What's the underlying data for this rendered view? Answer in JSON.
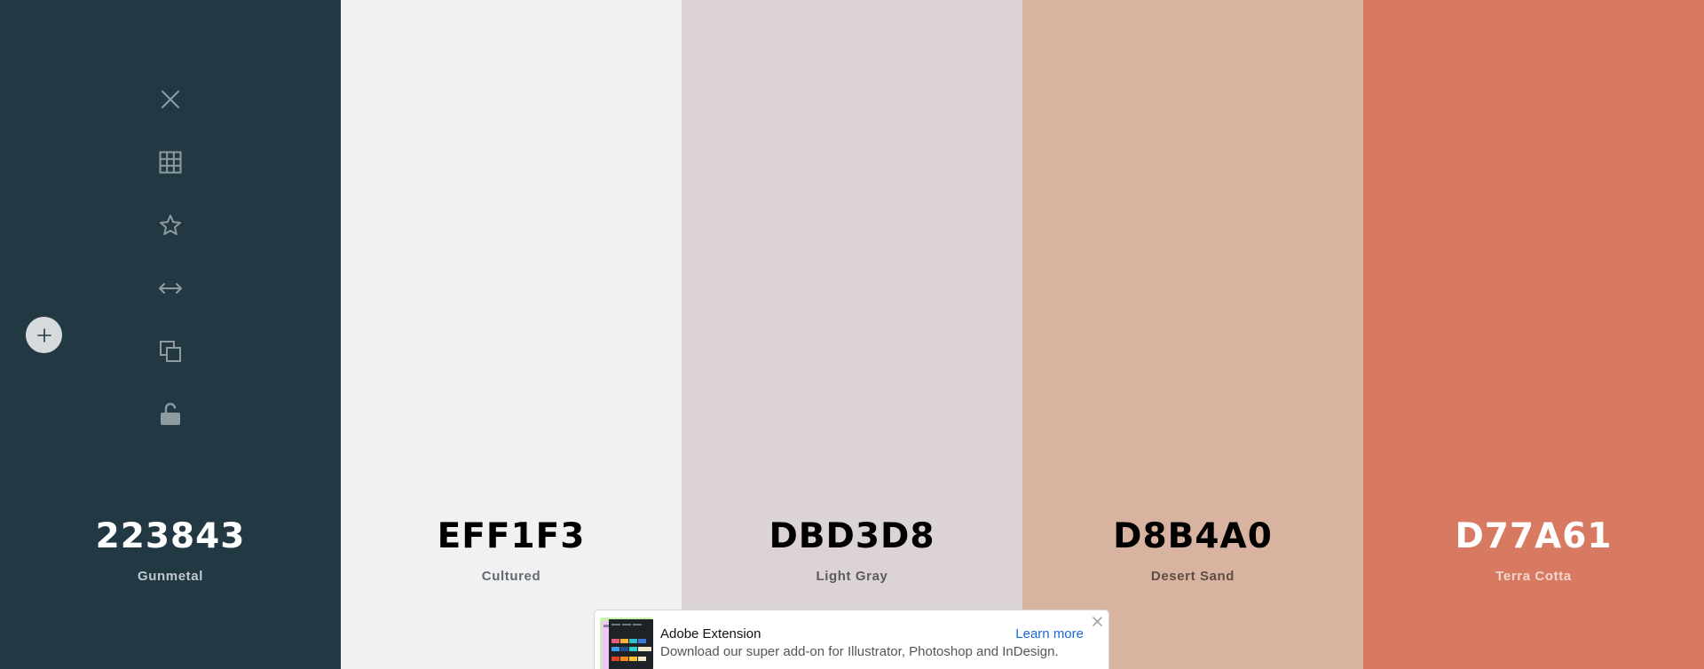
{
  "colors": [
    {
      "hex": "223843",
      "name": "Gunmetal",
      "bg": "#223843",
      "hex_color": "#ffffff",
      "name_color": "#c3c9cd"
    },
    {
      "hex": "EFF1F3",
      "name": "Cultured",
      "bg": "#EFF1F3",
      "hex_color": "#000000",
      "name_color": "#66696c"
    },
    {
      "hex": "DBD3D8",
      "name": "Light Gray",
      "bg": "#DBD3D8",
      "hex_color": "#000000",
      "name_color": "#5e5a5d"
    },
    {
      "hex": "D8B4A0",
      "name": "Desert Sand",
      "bg": "#D8B4A0",
      "hex_color": "#000000",
      "name_color": "#5d4d45"
    },
    {
      "hex": "D77A61",
      "name": "Terra Cotta",
      "bg": "#D77A61",
      "hex_color": "#ffffff",
      "name_color": "#f3d7cf"
    }
  ],
  "toolbar": {
    "icon_color": "#8f9ba1",
    "items": [
      {
        "icon": "close-icon"
      },
      {
        "icon": "grid-icon"
      },
      {
        "icon": "star-icon"
      },
      {
        "icon": "drag-horizontal-icon"
      },
      {
        "icon": "copy-icon"
      },
      {
        "icon": "unlock-icon"
      }
    ]
  },
  "add_button": {
    "icon": "plus-icon"
  },
  "ad": {
    "title": "Adobe Extension",
    "description": "Download our super add-on for Illustrator, Photoshop and InDesign.",
    "link": "Learn more",
    "close_icon": "close-icon"
  }
}
